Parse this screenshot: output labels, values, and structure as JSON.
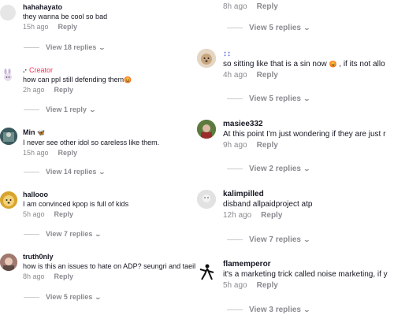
{
  "left": [
    {
      "user": "hahahayato",
      "text": "they wanna be cool so bad",
      "time": "15h ago",
      "reply": "Reply",
      "view": "View 18 replies"
    },
    {
      "user": ".·",
      "badge": "Creator",
      "text": "how can ppl still defending them",
      "time": "2h ago",
      "reply": "Reply",
      "view": "View 1 reply"
    },
    {
      "user": "Min",
      "text": "I never see other idol so careless like them.",
      "time": "15h ago",
      "reply": "Reply",
      "view": "View 14 replies"
    },
    {
      "user": "hallooo",
      "text": "I am convinced kpop is full of kids",
      "time": "5h ago",
      "reply": "Reply",
      "view": "View 7 replies"
    },
    {
      "user": "truth0nly",
      "text": "how is this an issues to hate on ADP? seungri and taeil",
      "time": "8h ago",
      "reply": "Reply",
      "view": "View 5 replies"
    }
  ],
  "right": [
    {
      "time": "8h ago",
      "reply": "Reply",
      "view": "View 5 replies"
    },
    {
      "user": "",
      "text": "so sitting like that is a sin now",
      "text2": ", if its not allo",
      "time": "4h ago",
      "reply": "Reply",
      "view": "View 5 replies"
    },
    {
      "user": "masiee332",
      "text": "At this point I'm just wondering if they are just r",
      "time": "9h ago",
      "reply": "Reply",
      "view": "View 2 replies"
    },
    {
      "user": "kalimpilled",
      "text": "disband allpaidproject atp",
      "time": "12h ago",
      "reply": "Reply",
      "view": "View 7 replies"
    },
    {
      "user": "flamemperor",
      "text": "it's a marketing trick called noise marketing, if y",
      "time": "5h ago",
      "reply": "Reply",
      "view": "View 3 replies"
    }
  ],
  "icons": {
    "chevron": "⌄",
    "angry_emoji": "😡",
    "butterfly_emoji": "🦋",
    "arrows_emoji": "↕↕"
  },
  "colors": {
    "accent": "#fe2c55",
    "muted": "#8a8b91",
    "text": "#161823"
  }
}
